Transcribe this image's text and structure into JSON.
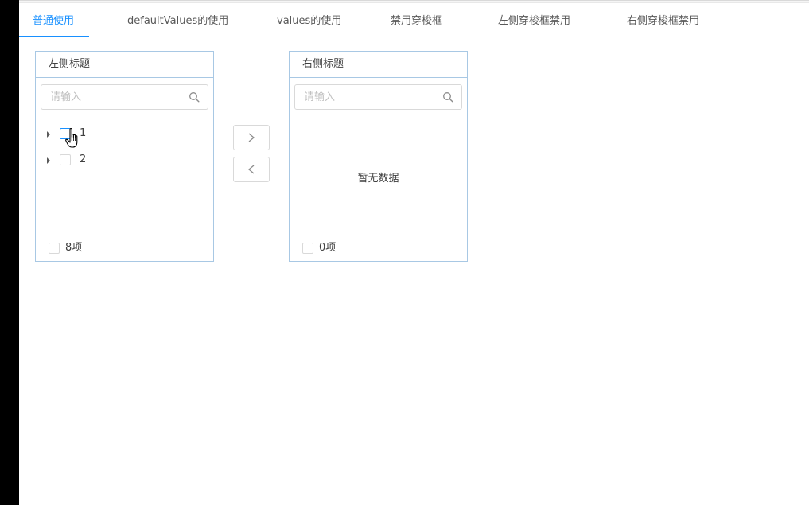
{
  "tabs": [
    {
      "label": "普通使用",
      "active": true
    },
    {
      "label": "defaultValues的使用",
      "active": false
    },
    {
      "label": "values的使用",
      "active": false
    },
    {
      "label": "禁用穿梭框",
      "active": false
    },
    {
      "label": "左侧穿梭框禁用",
      "active": false
    },
    {
      "label": "右侧穿梭框禁用",
      "active": false
    }
  ],
  "left_panel": {
    "title": "左侧标题",
    "search_placeholder": "请输入",
    "items": [
      {
        "label": "1",
        "checked": false
      },
      {
        "label": "2",
        "checked": false
      }
    ],
    "footer_count": "8项"
  },
  "right_panel": {
    "title": "右侧标题",
    "search_placeholder": "请输入",
    "empty_text": "暂无数据",
    "footer_count": "0项"
  },
  "operations": {
    "move_right_icon": "chevron-right-icon",
    "move_left_icon": "chevron-left-icon"
  },
  "colors": {
    "accent": "#1890ff",
    "panel_border": "#a8c8e4",
    "tab_text": "#595959",
    "placeholder": "#bfbfbf"
  }
}
